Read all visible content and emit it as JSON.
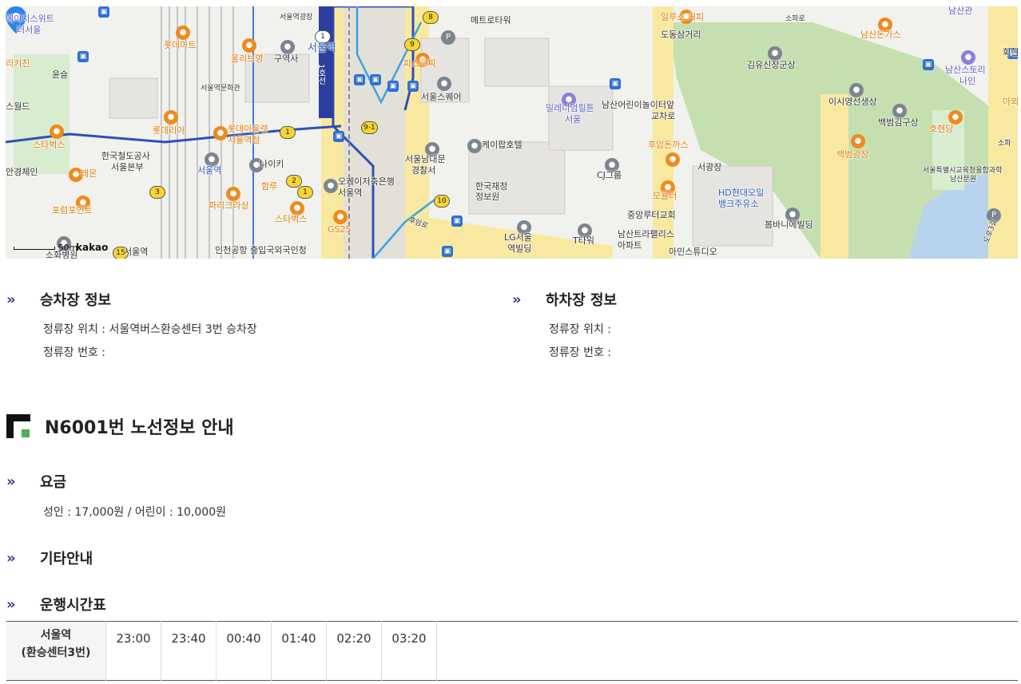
{
  "map": {
    "attribution": "kakao",
    "scale_label": "50m",
    "labels": {
      "l1": "에이치스위트",
      "l2": "더서울",
      "l3": "리키친",
      "l4": "윤슬",
      "l5": "스월드",
      "l6": "스타벅스",
      "l7": "안경체인",
      "l8": "레몬",
      "l9": "포럼포인트",
      "l10": "롯데마트",
      "l11": "올리브영",
      "l12": "구역사",
      "l13": "서울역광장",
      "l14": "서울역문화관",
      "l15": "롯데리아",
      "l16": "롯데아울렛",
      "l17": "서울역점",
      "l18": "한국철도공사",
      "l19": "서울본부",
      "l20": "서울역",
      "l21": "나이키",
      "l22": "함루",
      "l23": "파리크라상",
      "l24": "스타벅스",
      "l25": "GS25",
      "l26": "오케이저축은행",
      "l27": "서울역",
      "l28": "인천공항 출입국외국인청",
      "l29": "서울역",
      "l30": "소화병원",
      "l31": "1호선",
      "l32": "서울역",
      "l33": "메트로타워",
      "l34": "파스쿠찌",
      "l35": "서울스퀘어",
      "l36": "케이팝호텔",
      "l37": "서울남대문",
      "l38": "경찰서",
      "l39": "한국재정",
      "l40": "정보원",
      "l41": "LG서울",
      "l42": "역빌딩",
      "l43": "후암로",
      "l44": "밀레니엄힐튼",
      "l45": "서울",
      "l46": "일루소 커피",
      "l47": "도동삼거리",
      "l48": "남산어린이놀이터앞",
      "l49": "교차로",
      "l50": "후암돈까스",
      "l51": "CJ그룹",
      "l52": "서광장",
      "l53": "모듈러",
      "l54": "중앙루터교회",
      "l55": "HD현대오일",
      "l56": "뱅크주유소",
      "l57": "T타워",
      "l58": "남산트라팰리스",
      "l59": "아파트",
      "l60": "아민스튜디오",
      "l61": "소파로",
      "l62": "김유신장군상",
      "l63": "이시영선생상",
      "l64": "백범김구상",
      "l65": "호현당",
      "l66": "백범광장",
      "l67": "봄바니에빌딩",
      "l68": "남산관",
      "l69": "남산돈가스",
      "l70": "회현",
      "l71": "남산스토리",
      "l72": "나인",
      "l73": "마뫼",
      "l74": "소파",
      "l75": "서울특별시교육청융합과학",
      "l76": "남산분원",
      "l77": "도로3길"
    }
  },
  "boarding": {
    "heading": "승차장 정보",
    "location_line": "정류장 위치 : 서울역버스환승센터 3번 승차장",
    "number_line": "정류장 번호 :"
  },
  "alighting": {
    "heading": "하차장 정보",
    "location_line": "정류장 위치 :",
    "number_line": "정류장 번호 :"
  },
  "route": {
    "title": "N6001번 노선정보 안내"
  },
  "fare": {
    "heading": "요금",
    "text": "성인 : 17,000원 / 어린이 : 10,000원"
  },
  "other": {
    "heading": "기타안내"
  },
  "schedule": {
    "heading": "운행시간표",
    "station_line1": "서울역",
    "station_line2": "(환승센터3번)",
    "times": [
      "23:00",
      "23:40",
      "00:40",
      "01:40",
      "02:20",
      "03:20"
    ]
  },
  "colors": {
    "accent_chevron": "#4b2fa0",
    "route_line": "#2f4fb8",
    "park": "#b7d4a5",
    "road_major": "#f7e79a"
  }
}
